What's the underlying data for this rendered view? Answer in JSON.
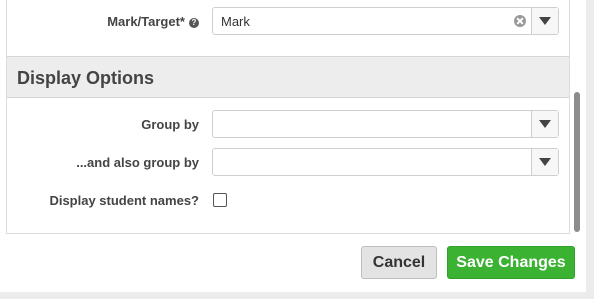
{
  "form": {
    "mark_target": {
      "label": "Mark/Target*",
      "help_icon": "question-circle-icon",
      "value": "Mark"
    }
  },
  "display_options": {
    "title": "Display Options",
    "group_by": {
      "label": "Group by",
      "value": ""
    },
    "also_group_by": {
      "label": "...and also group by",
      "value": ""
    },
    "display_student_names": {
      "label": "Display student names?",
      "checked": false
    }
  },
  "footer": {
    "cancel_label": "Cancel",
    "save_label": "Save Changes"
  },
  "colors": {
    "save_button": "#3cb233",
    "cancel_button": "#e3e3e3",
    "section_header": "#ededed"
  }
}
